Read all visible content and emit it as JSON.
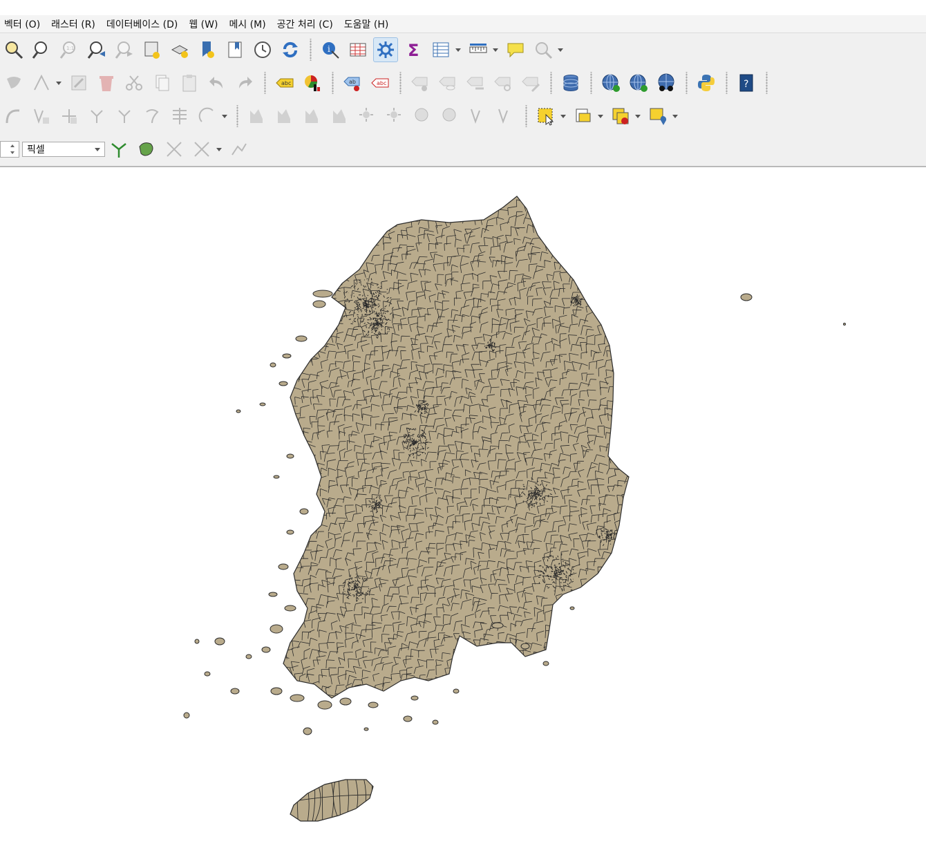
{
  "menu": {
    "items": [
      {
        "label": "벡터 (O)"
      },
      {
        "label": "래스터 (R)"
      },
      {
        "label": "데이터베이스 (D)"
      },
      {
        "label": "웹 (W)"
      },
      {
        "label": "메시 (M)"
      },
      {
        "label": "공간 처리 (C)"
      },
      {
        "label": "도움말 (H)"
      }
    ]
  },
  "toolbars": {
    "navigation": [
      "zoom-in-icon",
      "zoom-out-icon",
      "zoom-native-icon",
      "zoom-last-icon",
      "zoom-next-icon",
      "new-map-view-icon",
      "new-3d-view-icon",
      "new-bookmark-icon",
      "show-bookmarks-icon",
      "temporal-controller-icon",
      "refresh-icon",
      "identify-icon",
      "attribute-table-icon",
      "processing-toolbox-icon",
      "statistics-icon",
      "open-table-icon",
      "measure-icon",
      "map-tips-icon",
      "locator-icon"
    ],
    "digitizing": [
      "move-feature-icon",
      "node-tool-icon",
      "edit-attributes-icon",
      "delete-icon",
      "cut-icon",
      "copy-icon",
      "paste-icon",
      "undo-icon",
      "redo-icon",
      "label-tool-icon",
      "diagram-icon",
      "pin-label-icon",
      "show-hide-label-icon",
      "database-icon",
      "wms-icon",
      "wfs-icon",
      "georeferencer-icon",
      "python-icon",
      "help-icon"
    ],
    "advanced_digitizing": [
      "reshape-icon",
      "vertex-icon",
      "split-icon",
      "merge-icon",
      "offset-icon",
      "rotate-icon",
      "simplify-icon",
      "select-feature-icon",
      "select-by-value-icon",
      "deselect-icon",
      "select-location-icon"
    ],
    "snapping": {
      "units_value": "픽셀"
    }
  },
  "map": {
    "fill_color": "#b9ab8c",
    "stroke_color": "#2b2b2b",
    "background": "#ffffff"
  }
}
